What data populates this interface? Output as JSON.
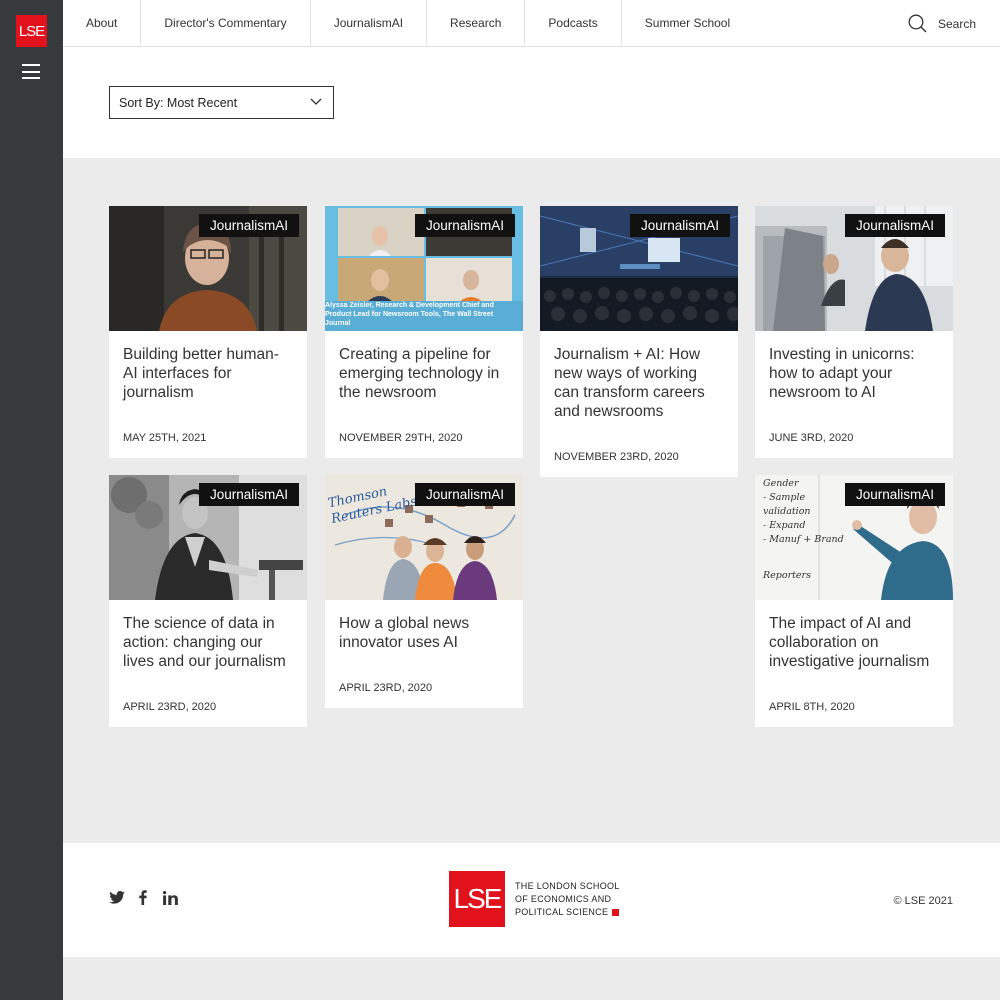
{
  "brand": {
    "logo_text": "LSE",
    "accent": "#e1121b",
    "sidebar_bg": "#373a3d"
  },
  "nav": {
    "items": [
      {
        "label": "About"
      },
      {
        "label": "Director's Commentary"
      },
      {
        "label": "JournalismAI"
      },
      {
        "label": "Research"
      },
      {
        "label": "Podcasts"
      },
      {
        "label": "Summer School"
      }
    ],
    "search_label": "Search"
  },
  "sort": {
    "label": "Sort By: Most Recent"
  },
  "cards": [
    {
      "tag": "JournalismAI",
      "title": "Building better human-AI interfaces for journalism",
      "date": "MAY 25TH, 2021"
    },
    {
      "tag": "JournalismAI",
      "title": "Creating a pipeline for emerging technology in the newsroom",
      "date": "NOVEMBER 29TH, 2020",
      "caption": "Alyssa Zeisler, Research & Development Chief and Product Lead for Newsroom Tools, The Wall Street Journal"
    },
    {
      "tag": "JournalismAI",
      "title": "Journalism + AI: How new ways of working can transform careers and newsrooms",
      "date": "NOVEMBER 23RD, 2020"
    },
    {
      "tag": "JournalismAI",
      "title": "Investing in unicorns: how to adapt your newsroom to AI",
      "date": "JUNE 3RD, 2020"
    },
    {
      "tag": "JournalismAI",
      "title": "The science of data in action: changing our lives and our journalism",
      "date": "APRIL 23RD, 2020"
    },
    {
      "tag": "JournalismAI",
      "title": "How a global news innovator uses AI",
      "date": "APRIL 23RD, 2020",
      "whiteboard_text": "Thomson Reuters Labs"
    },
    {
      "tag": "JournalismAI",
      "title": "The impact of AI and collaboration on investigative journalism",
      "date": "APRIL 8TH, 2020",
      "whiteboard_lines": [
        "Gender",
        "- Sample validation",
        "- Expand",
        "- Manuf + Brand",
        "Reporters"
      ]
    }
  ],
  "footer": {
    "logo_box": "LSE",
    "logo_lines": [
      "THE LONDON SCHOOL",
      "OF ECONOMICS AND",
      "POLITICAL SCIENCE"
    ],
    "copyright": "© LSE 2021",
    "social": [
      "twitter-icon",
      "facebook-icon",
      "linkedin-icon"
    ]
  }
}
